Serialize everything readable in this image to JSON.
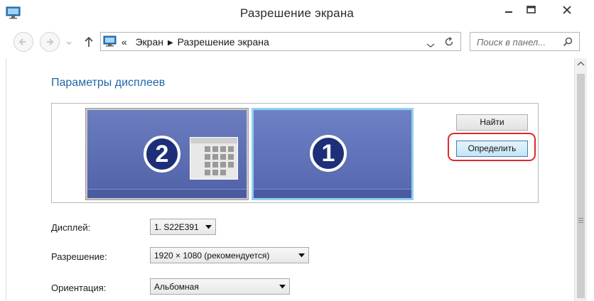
{
  "window": {
    "title": "Разрешение экрана",
    "icons": {
      "app": "monitor-icon",
      "minimize": "minimize-icon",
      "maximize": "maximize-icon",
      "close": "close-icon"
    }
  },
  "nav": {
    "breadcrumb_prefix": "«",
    "breadcrumb": [
      "Экран",
      "Разрешение экрана"
    ],
    "breadcrumb_separator": "▶",
    "search_placeholder": "Поиск в панел..."
  },
  "main": {
    "section_title": "Параметры дисплеев",
    "monitors": [
      {
        "number": "2",
        "selected": false
      },
      {
        "number": "1",
        "selected": true
      }
    ],
    "find_button": "Найти",
    "identify_button": "Определить",
    "highlight_color": "#e0282e"
  },
  "settings": {
    "display_label": "Дисплей:",
    "display_value": "1. S22E391",
    "resolution_label": "Разрешение:",
    "resolution_value": "1920 × 1080 (рекомендуется)",
    "orientation_label": "Ориентация:",
    "orientation_value": "Альбомная"
  },
  "colors": {
    "accent_title": "#1e67a8",
    "monitor_fill": "#5a6bad",
    "selected_border": "#8fd0f1",
    "badge_fill": "#1d2f78"
  }
}
